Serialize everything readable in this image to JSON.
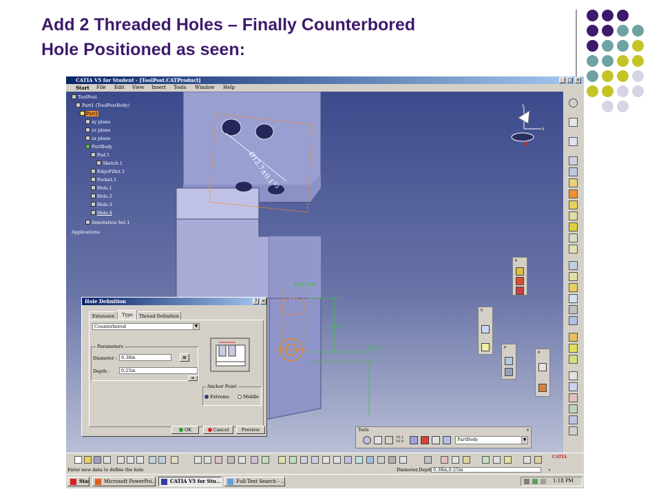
{
  "slide": {
    "title_line1": "Add 2 Threaded Holes – Finally Counterbored",
    "title_line2": "Hole Positioned as seen:"
  },
  "app": {
    "title": "CATIA V5 for Student - [ToolPost.CATProduct]",
    "menu": [
      "Start",
      "File",
      "Edit",
      "View",
      "Insert",
      "Tools",
      "Window",
      "Help"
    ],
    "window_controls": [
      "_",
      "□",
      "×"
    ]
  },
  "tree": {
    "items": [
      {
        "label": "ToolPost",
        "selected": false
      },
      {
        "label": "Part1 (ToolPostBody)",
        "selected": false
      },
      {
        "label": "Part1",
        "selected": false
      },
      {
        "label": "xy plane",
        "selected": false
      },
      {
        "label": "yz plane",
        "selected": false
      },
      {
        "label": "zx plane",
        "selected": false
      },
      {
        "label": "PartBody",
        "selected": false
      },
      {
        "label": "Pad.1",
        "selected": false
      },
      {
        "label": "Sketch.1",
        "selected": false
      },
      {
        "label": "EdgeFillet.1",
        "selected": false
      },
      {
        "label": "Pocket.1",
        "selected": false
      },
      {
        "label": "Hole.1",
        "selected": false
      },
      {
        "label": "Hole.2",
        "selected": false
      },
      {
        "label": "Hole.3",
        "selected": false
      },
      {
        "label": "Hole.4",
        "selected": true
      },
      {
        "label": "Annotation Set.1",
        "selected": false
      },
      {
        "label": "Applications",
        "selected": false
      }
    ]
  },
  "model": {
    "diameter_annotation": "Ø12.7±0.1",
    "tolerance_annotation": "05",
    "dim_height": "(1.437)",
    "dim_width": "0.375",
    "bottom_label": "BOTTOM"
  },
  "compass": {
    "z_label": "z",
    "x_label": "x"
  },
  "dialog": {
    "title": "Hole Definition",
    "title_help": "?",
    "title_close": "×",
    "tabs": [
      "Extension",
      "Type",
      "Thread Definition"
    ],
    "type_value": "Counterbored",
    "parameters_label": "Parameters",
    "diameter_label": "Diameter :",
    "diameter_value": "0.38in",
    "depth_label": "Depth :",
    "depth_value": "0.25in",
    "anchor_label": "Anchor Point",
    "anchor_extreme": "Extreme",
    "anchor_middle": "Middle",
    "ok_label": "OK",
    "cancel_label": "Cancel",
    "preview_label": "Preview"
  },
  "tools_toolbar": {
    "title": "Tools",
    "close": "×",
    "body_select": "PartBody",
    "grid_label_top": "10.1",
    "grid_label_bottom": "10.0"
  },
  "status": {
    "prompt": "Enter new data to define the hole",
    "readout": "Diameter,Depth",
    "input_value": "0.38in,0.25in"
  },
  "taskbar": {
    "start": "Start",
    "tasks": [
      "Microsoft PowerPoi...",
      "CATIA V5 for Stu...",
      "Full-Text Search - ..."
    ],
    "clock": "1:18 PM"
  },
  "colors": {
    "title": "#3d1a6b",
    "dot_purple": "#3d1a6b",
    "dot_teal": "#6fa3a3",
    "dot_olive": "#c4c428",
    "dot_lavender": "#d5d5e6",
    "viewport_top": "#3c4a8c",
    "selection_orange": "#f08a20",
    "dimension_green": "#40c040"
  }
}
